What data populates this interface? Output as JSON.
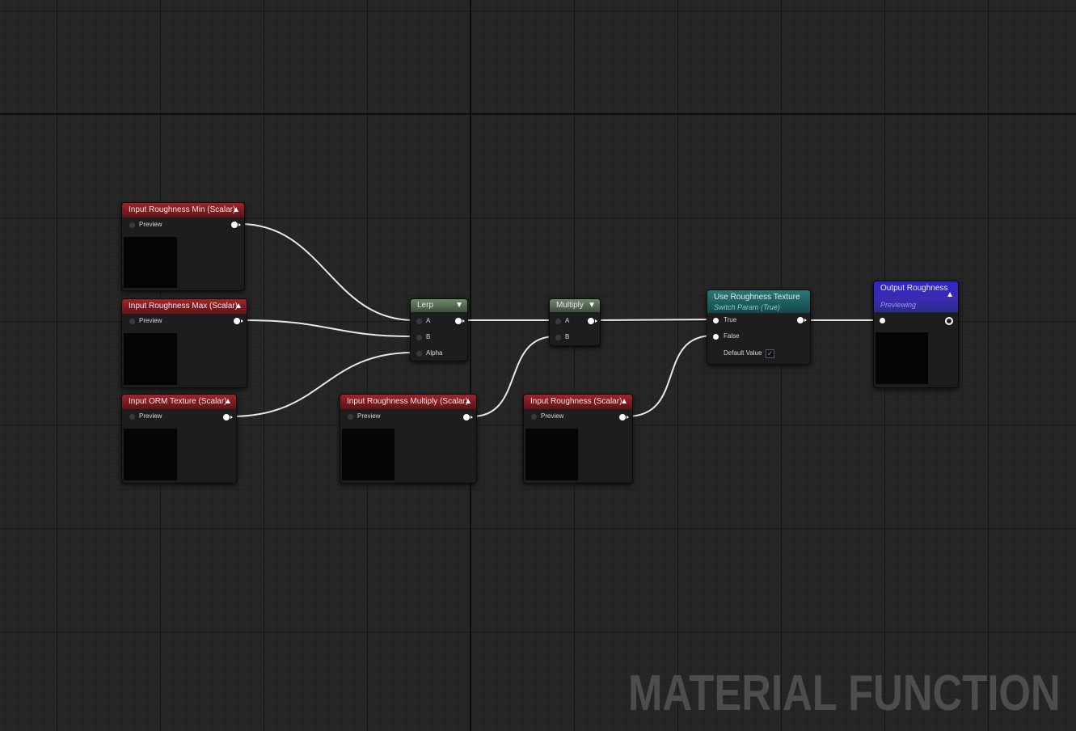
{
  "editor": {
    "watermark": "MATERIAL FUNCTION"
  },
  "nodes": {
    "roughness_min": {
      "title": "Input Roughness Min (Scalar)",
      "pin": "Preview"
    },
    "roughness_max": {
      "title": "Input Roughness Max (Scalar)",
      "pin": "Preview"
    },
    "orm_texture": {
      "title": "Input ORM Texture (Scalar)",
      "pin": "Preview"
    },
    "roughness_multiply": {
      "title": "Input Roughness Multiply (Scalar)",
      "pin": "Preview"
    },
    "roughness": {
      "title": "Input Roughness (Scalar)",
      "pin": "Preview"
    },
    "lerp": {
      "title": "Lerp",
      "pins": [
        "A",
        "B",
        "Alpha"
      ]
    },
    "multiply": {
      "title": "Multiply",
      "pins": [
        "A",
        "B"
      ]
    },
    "switch": {
      "title": "Use Roughness Texture",
      "subtitle": "Switch Param (True)",
      "pins": [
        "True",
        "False"
      ],
      "default_label": "Default Value",
      "default_checked": true
    },
    "output": {
      "title": "Output Roughness",
      "subtitle": "Previewing"
    }
  },
  "colors": {
    "input_header": "#a0242a",
    "math_header": "#6e8a6a",
    "switch_header": "#267a7a",
    "output_header": "#2c28c8",
    "wire": "#e8e8e8"
  },
  "icons": {
    "collapse": "chevron-up-icon",
    "dropdown": "chevron-down-icon",
    "check": "checkmark-icon"
  }
}
